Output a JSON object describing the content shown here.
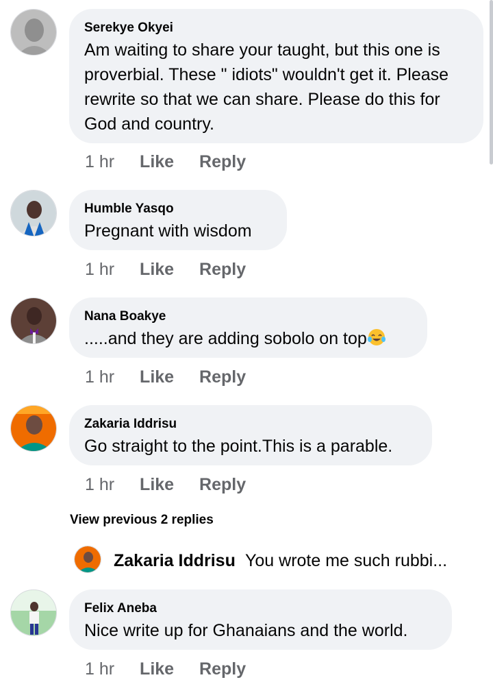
{
  "comments": [
    {
      "author": "Serekye Okyei",
      "text": "Am waiting to share your taught, but this one is proverbial. These \" idiots\" wouldn't get it. Please rewrite so that we can share. Please do this for God and country.",
      "time": "1 hr",
      "like_label": "Like",
      "reply_label": "Reply",
      "avatar_icon": "avatar-serekye-okyei"
    },
    {
      "author": "Humble Yasqo",
      "text": "Pregnant with wisdom",
      "time": "1 hr",
      "like_label": "Like",
      "reply_label": "Reply",
      "avatar_icon": "avatar-humble-yasqo"
    },
    {
      "author": "Nana Boakye",
      "text": ".....and they are adding sobolo on top",
      "emoji": "tears-of-joy-emoji",
      "time": "1 hr",
      "like_label": "Like",
      "reply_label": "Reply",
      "avatar_icon": "avatar-nana-boakye"
    },
    {
      "author": "Zakaria Iddrisu",
      "text": "Go straight to the point.This is a parable.",
      "time": "1 hr",
      "like_label": "Like",
      "reply_label": "Reply",
      "avatar_icon": "avatar-zakaria-iddrisu"
    },
    {
      "author": "Felix Aneba",
      "text": "Nice write up for Ghanaians  and the world.",
      "time": "1 hr",
      "like_label": "Like",
      "reply_label": "Reply",
      "avatar_icon": "avatar-felix-aneba"
    }
  ],
  "view_previous_replies": "View previous 2 replies",
  "reply_preview": {
    "author": "Zakaria Iddrisu",
    "text": "You wrote me such rubbi...",
    "avatar_icon": "avatar-zakaria-iddrisu"
  },
  "colors": {
    "bubble": "#f0f2f5",
    "meta_text": "#65676b",
    "primary_text": "#050505"
  }
}
